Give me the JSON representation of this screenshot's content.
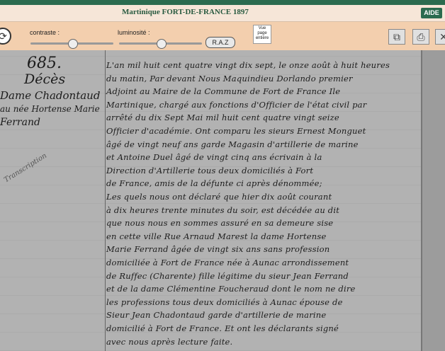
{
  "header": {
    "title": "Martinique FORT-DE-FRANCE 1897",
    "help_label": "AIDE"
  },
  "toolbar": {
    "contrast_label": "contraste :",
    "luminosity_label": "luminosité :",
    "contrast_level": 0.5,
    "luminosity_level": 0.5,
    "reset_label": "R.A.Z",
    "full_page_label": "Vue page entière",
    "icons": [
      "rotate-icon",
      "zoom-icon",
      "print-icon",
      "close-icon"
    ]
  },
  "document": {
    "entry_number": "685.",
    "margin_heading": "Décès",
    "margin_names": [
      "Dame Chadontaud",
      "au née Hortense Marie",
      "Ferrand"
    ],
    "margin_note": "Transcription",
    "lines": [
      "L'an mil huit cent quatre vingt dix sept, le onze août à huit heures",
      "du matin, Par devant Nous Maquindieu Dorlando premier",
      "Adjoint au Maire de la Commune de Fort de France Ile",
      "Martinique, chargé aux fonctions d'Officier de l'état civil par",
      "arrêté du dix Sept Mai mil huit cent quatre vingt seize",
      "Officier d'académie. Ont comparu les sieurs Ernest Monguet",
      "âgé de vingt neuf ans garde Magasin d'artillerie de marine",
      "et Antoine Duel âgé de vingt cinq ans écrivain à la",
      "Direction d'Artillerie tous deux domiciliés à Fort",
      "de France, amis de la défunte ci après dénommée;",
      "Les quels nous ont déclaré que hier dix août courant",
      "à dix heures trente minutes du soir, est décédée au dit",
      "que nous nous en sommes assuré en sa demeure sise",
      "en cette ville Rue Arnaud Marest la dame Hortense",
      "Marie Ferrand âgée de vingt six ans sans profession",
      "domiciliée à Fort de France née à Aunac arrondissement",
      "de Ruffec (Charente) fille légitime du sieur Jean Ferrand",
      "et de la dame Clémentine Foucheraud dont le nom ne dire",
      "les professions tous deux domiciliés à Aunac épouse de",
      "Sieur Jean Chadontaud garde d'artillerie de marine",
      "domicilié à Fort de France. Et ont les déclarants signé",
      "avec nous après lecture faite."
    ]
  }
}
